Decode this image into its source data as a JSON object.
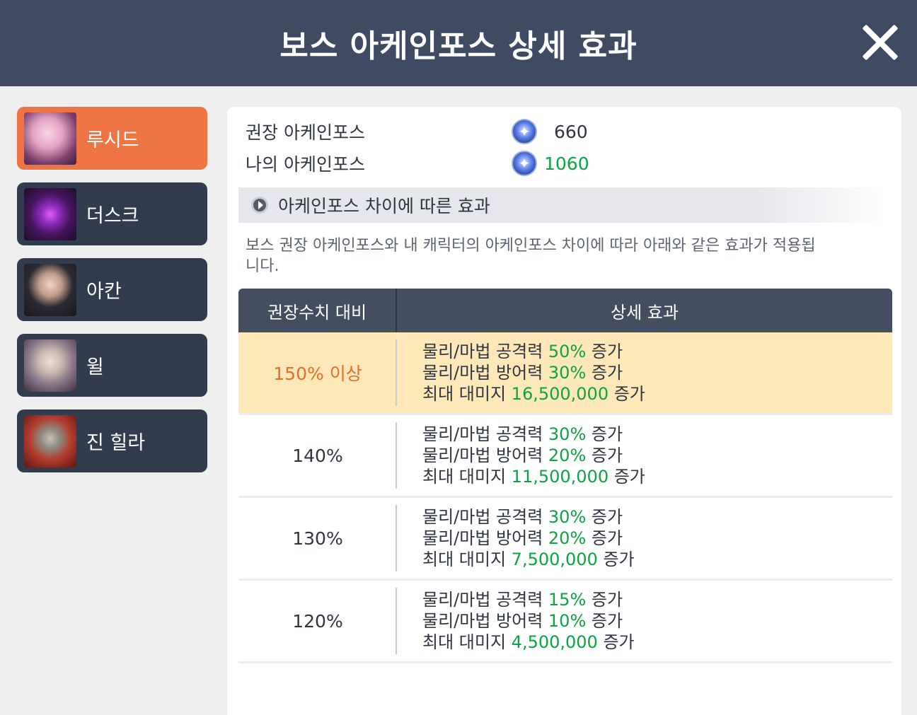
{
  "title": "보스 아케인포스 상세 효과",
  "close_icon": "close-icon",
  "bosses": [
    {
      "name": "루시드",
      "avatar": "lucid-portrait",
      "active": true
    },
    {
      "name": "더스크",
      "avatar": "dusk-portrait",
      "active": false
    },
    {
      "name": "아칸",
      "avatar": "akan-portrait",
      "active": false
    },
    {
      "name": "윌",
      "avatar": "will-portrait",
      "active": false
    },
    {
      "name": "진 힐라",
      "avatar": "verus-hilla-portrait",
      "active": false
    }
  ],
  "arcane": {
    "recommended_label": "권장 아케인포스",
    "recommended_value": "660",
    "mine_label": "나의 아케인포스",
    "mine_value": "1060"
  },
  "section_title": "아케인포스 차이에 따른 효과",
  "description": "보스 권장 아케인포스와 내 캐릭터의 아케인포스 차이에 따라 아래와 같은 효과가 적용됩니다.",
  "table": {
    "headers": [
      "권장수치 대비",
      "상세 효과"
    ],
    "rows": [
      {
        "ratio": "150% 이상",
        "atk_pre": "물리/마법 공격력 ",
        "atk": "50%",
        "def_pre": "물리/마법 방어력 ",
        "def": "30%",
        "dmg_pre": "최대 대미지 ",
        "dmg": "16,500,000",
        "suffix": " 증가"
      },
      {
        "ratio": "140%",
        "atk_pre": "물리/마법 공격력 ",
        "atk": "30%",
        "def_pre": "물리/마법 방어력 ",
        "def": "20%",
        "dmg_pre": "최대 대미지 ",
        "dmg": "11,500,000",
        "suffix": " 증가"
      },
      {
        "ratio": "130%",
        "atk_pre": "물리/마법 공격력 ",
        "atk": "30%",
        "def_pre": "물리/마법 방어력 ",
        "def": "20%",
        "dmg_pre": "최대 대미지 ",
        "dmg": "7,500,000",
        "suffix": " 증가"
      },
      {
        "ratio": "120%",
        "atk_pre": "물리/마법 공격력 ",
        "atk": "15%",
        "def_pre": "물리/마법 방어력 ",
        "def": "10%",
        "dmg_pre": "최대 대미지 ",
        "dmg": "4,500,000",
        "suffix": " 증가"
      }
    ]
  },
  "colors": {
    "titlebar": "#3f4b63",
    "active_tab": "#ef7644",
    "inactive_tab": "#323c4f",
    "highlight_row": "#ffe8b8",
    "value_green": "#0aa541",
    "ratio_orange": "#e0702a"
  }
}
